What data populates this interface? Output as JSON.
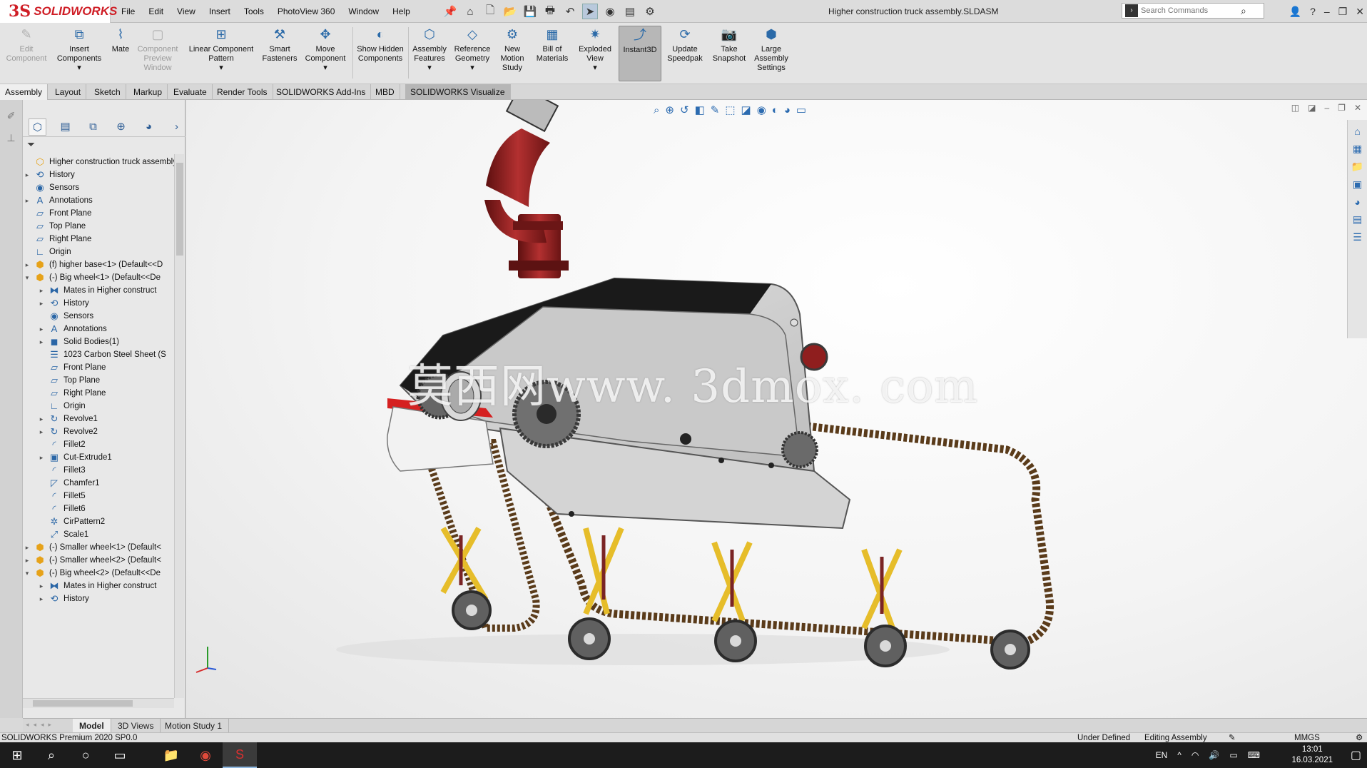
{
  "app": {
    "logo_ds": "3S",
    "logo_text": "SOLIDWORKS",
    "doc_title": "Higher construction truck assembly.SLDASM",
    "menus": [
      "File",
      "Edit",
      "View",
      "Insert",
      "Tools",
      "PhotoView 360",
      "Window",
      "Help"
    ],
    "search_placeholder": "Search Commands"
  },
  "ribbon": {
    "edit_component": "Edit Component",
    "insert_components": "Insert Components",
    "mate": "Mate",
    "component_preview": "Component Preview Window",
    "linear_pattern": "Linear Component Pattern",
    "smart_fasteners": "Smart Fasteners",
    "move_component": "Move Component",
    "show_hidden": "Show Hidden Components",
    "assembly_features": "Assembly Features",
    "reference_geometry": "Reference Geometry",
    "new_motion_study": "New Motion Study",
    "bill_of_materials": "Bill of Materials",
    "exploded_view": "Exploded View",
    "instant3d": "Instant3D",
    "update_speedpak": "Update Speedpak",
    "take_snapshot": "Take Snapshot",
    "large_assembly_settings": "Large Assembly Settings"
  },
  "tabs": {
    "assembly": "Assembly",
    "layout": "Layout",
    "sketch": "Sketch",
    "markup": "Markup",
    "evaluate": "Evaluate",
    "render_tools": "Render Tools",
    "addins": "SOLIDWORKS Add-Ins",
    "mbd": "MBD",
    "visualize": "SOLIDWORKS Visualize"
  },
  "tree": {
    "root": "Higher construction truck assembly",
    "n1": "History",
    "n2": "Sensors",
    "n3": "Annotations",
    "n4": "Front Plane",
    "n5": "Top Plane",
    "n6": "Right Plane",
    "n7": "Origin",
    "n8": "(f) higher base<1> (Default<<D",
    "n9": "(-) Big wheel<1> (Default<<De",
    "n10": "Mates in Higher construct",
    "n11": "History",
    "n12": "Sensors",
    "n13": "Annotations",
    "n14": "Solid Bodies(1)",
    "n15": "1023 Carbon Steel Sheet (S",
    "n16": "Front Plane",
    "n17": "Top Plane",
    "n18": "Right Plane",
    "n19": "Origin",
    "n20": "Revolve1",
    "n21": "Revolve2",
    "n22": "Fillet2",
    "n23": "Cut-Extrude1",
    "n24": "Fillet3",
    "n25": "Chamfer1",
    "n26": "Fillet5",
    "n27": "Fillet6",
    "n28": "CirPattern2",
    "n29": "Scale1",
    "n30": "(-) Smaller wheel<1> (Default<",
    "n31": "(-) Smaller wheel<2> (Default<",
    "n32": "(-) Big wheel<2> (Default<<De",
    "n33": "Mates in Higher construct",
    "n34": "History"
  },
  "viewport": {
    "watermark": "莫西网www. 3dmox. com"
  },
  "bottom_tabs": {
    "model": "Model",
    "views3d": "3D Views",
    "motion": "Motion Study 1"
  },
  "status": {
    "version": "SOLIDWORKS Premium 2020 SP0.0",
    "under_defined": "Under Defined",
    "editing": "Editing Assembly",
    "units": "MMGS"
  },
  "taskbar": {
    "lang": "EN",
    "time": "13:01",
    "date": "16.03.2021"
  }
}
